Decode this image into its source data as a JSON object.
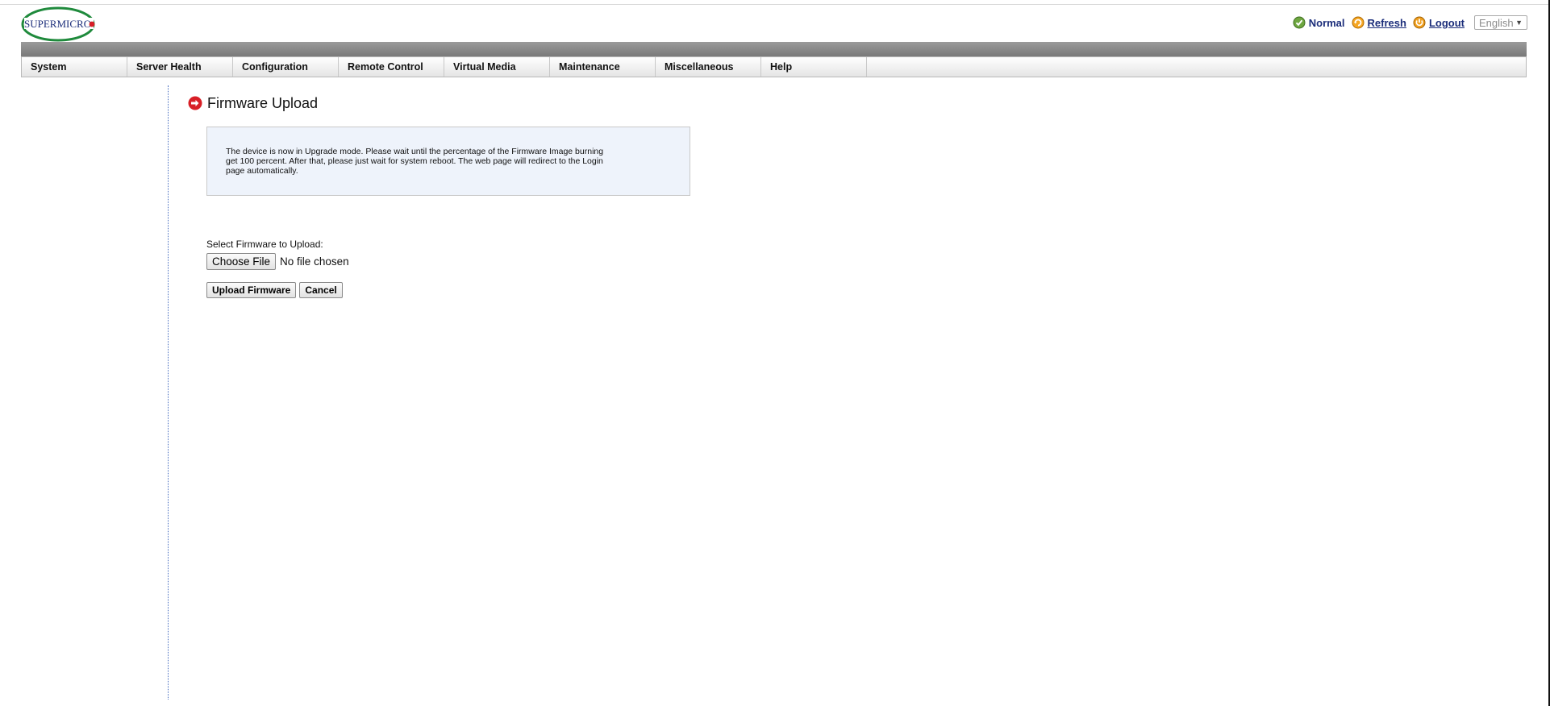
{
  "brand": {
    "logo_text": "SUPERMICRO"
  },
  "status_bar": {
    "status_label": "Normal",
    "refresh_label": "Refresh",
    "logout_label": "Logout",
    "language": "English",
    "icons": [
      "check-circle-icon",
      "refresh-icon",
      "logout-icon"
    ]
  },
  "nav": {
    "items": [
      {
        "label": "System"
      },
      {
        "label": "Server Health"
      },
      {
        "label": "Configuration"
      },
      {
        "label": "Remote Control"
      },
      {
        "label": "Virtual Media"
      },
      {
        "label": "Maintenance"
      },
      {
        "label": "Miscellaneous"
      },
      {
        "label": "Help"
      }
    ]
  },
  "main": {
    "title": "Firmware Upload",
    "info_message": "The device is now in Upgrade mode. Please wait until the percentage of the Firmware Image burning get 100 percent. After that, please just wait for system reboot. The web page will redirect to the Login page automatically.",
    "select_label": "Select Firmware to Upload:",
    "choose_file_label": "Choose File",
    "file_status": "No file chosen",
    "upload_label": "Upload Firmware",
    "cancel_label": "Cancel"
  },
  "colors": {
    "brand_green": "#1f8a3c",
    "brand_blue": "#1b2d7a",
    "accent_red": "#d81f26",
    "info_box_bg": "#eef3fb"
  }
}
